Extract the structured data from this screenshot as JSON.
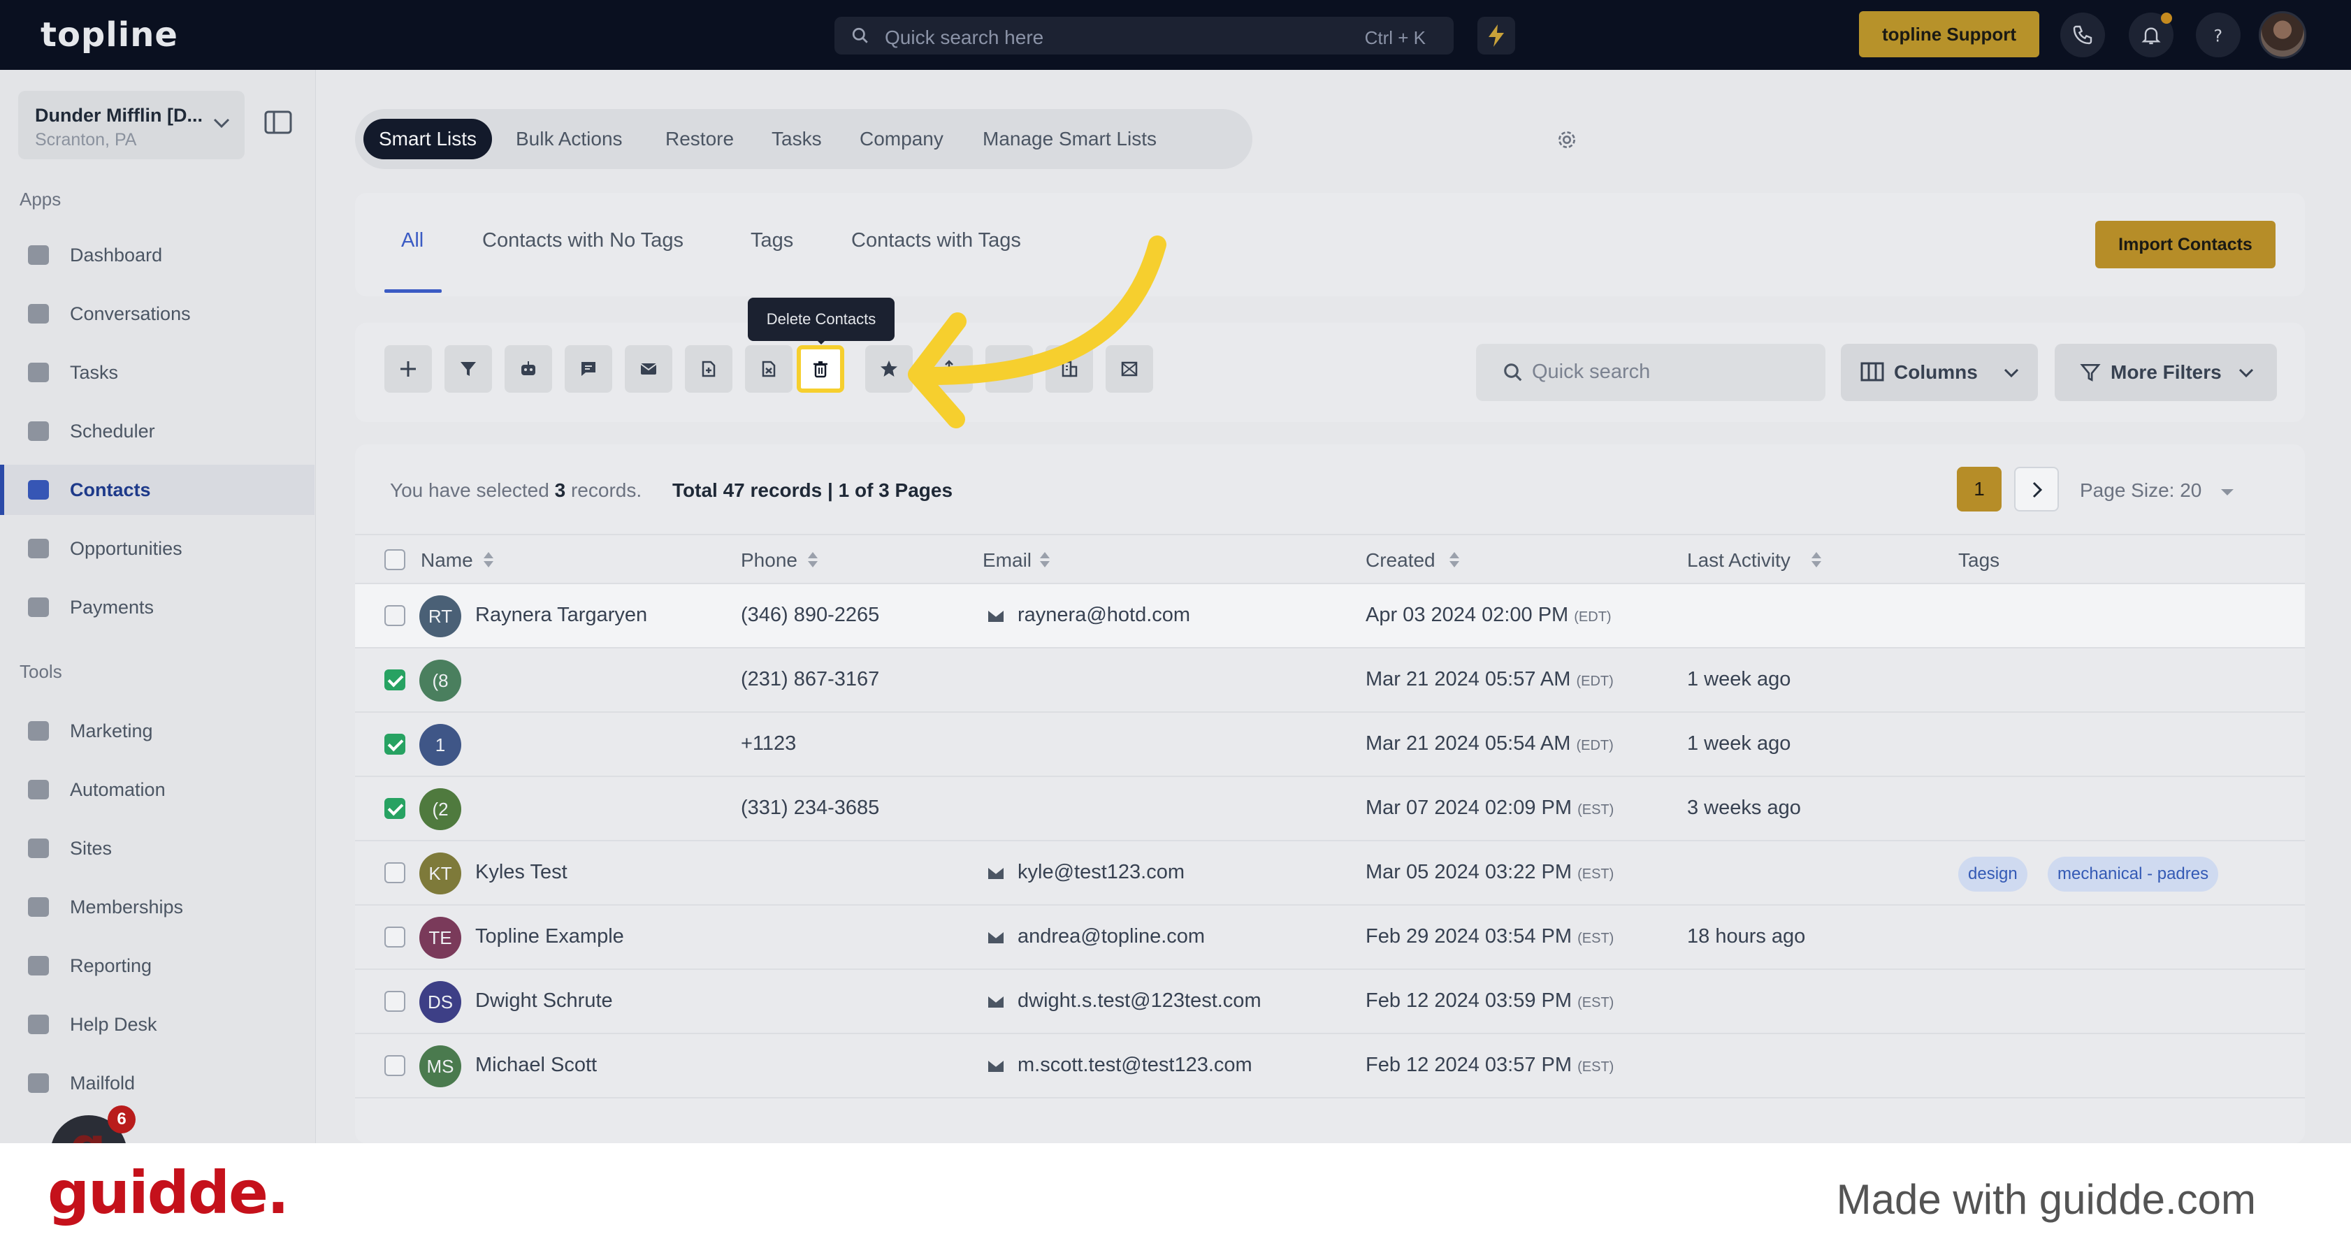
{
  "app": {
    "logo": "topline"
  },
  "header": {
    "search_placeholder": "Quick search here",
    "search_shortcut": "Ctrl + K",
    "support_label": "topline Support"
  },
  "sidebar": {
    "location_name": "Dunder Mifflin [D...",
    "location_sub": "Scranton, PA",
    "apps_label": "Apps",
    "tools_label": "Tools",
    "apps": [
      {
        "label": "Dashboard"
      },
      {
        "label": "Conversations"
      },
      {
        "label": "Tasks"
      },
      {
        "label": "Scheduler"
      },
      {
        "label": "Contacts"
      },
      {
        "label": "Opportunities"
      },
      {
        "label": "Payments"
      }
    ],
    "tools": [
      {
        "label": "Marketing"
      },
      {
        "label": "Automation"
      },
      {
        "label": "Sites"
      },
      {
        "label": "Memberships"
      },
      {
        "label": "Reporting"
      },
      {
        "label": "Help Desk"
      },
      {
        "label": "Mailfold"
      }
    ],
    "chat_count": "6"
  },
  "top_tabs": [
    "Smart Lists",
    "Bulk Actions",
    "Restore",
    "Tasks",
    "Company",
    "Manage Smart Lists"
  ],
  "sub_tabs": [
    "All",
    "Contacts with No Tags",
    "Tags",
    "Contacts with Tags"
  ],
  "import_label": "Import Contacts",
  "toolbar": {
    "tooltip": "Delete Contacts",
    "quick_search_placeholder": "Quick search",
    "columns_label": "Columns",
    "more_filters_label": "More Filters"
  },
  "records": {
    "selected_prefix": "You have selected",
    "selected_count": "3",
    "selected_suffix": "records.",
    "total": "Total 47 records | 1 of 3 Pages",
    "page": "1",
    "page_size": "Page Size: 20"
  },
  "table": {
    "headers": [
      "Name",
      "Phone",
      "Email",
      "Created",
      "Last Activity",
      "Tags"
    ],
    "rows": [
      {
        "initials": "RT",
        "color": "#4a6076",
        "name": "Raynera Targaryen",
        "phone": "(346) 890-2265",
        "email": "raynera@hotd.com",
        "created": "Apr 03 2024 02:00 PM",
        "tz": "(EDT)",
        "activity": "",
        "checked": false,
        "tags": []
      },
      {
        "initials": "(8",
        "color": "#4a7f5e",
        "name": "",
        "phone": "(231) 867-3167",
        "email": "",
        "created": "Mar 21 2024 05:57 AM",
        "tz": "(EDT)",
        "activity": "1 week ago",
        "checked": true,
        "tags": []
      },
      {
        "initials": "1",
        "color": "#3f5687",
        "name": "",
        "phone": "+1123",
        "email": "",
        "created": "Mar 21 2024 05:54 AM",
        "tz": "(EDT)",
        "activity": "1 week ago",
        "checked": true,
        "tags": []
      },
      {
        "initials": "(2",
        "color": "#4f7a3e",
        "name": "",
        "phone": "(331) 234-3685",
        "email": "",
        "created": "Mar 07 2024 02:09 PM",
        "tz": "(EST)",
        "activity": "3 weeks ago",
        "checked": true,
        "tags": []
      },
      {
        "initials": "KT",
        "color": "#7e7a3a",
        "name": "Kyles Test",
        "phone": "",
        "email": "kyle@test123.com",
        "created": "Mar 05 2024 03:22 PM",
        "tz": "(EST)",
        "activity": "",
        "checked": false,
        "tags": [
          "design",
          "mechanical - padres"
        ]
      },
      {
        "initials": "TE",
        "color": "#7a3a5a",
        "name": "Topline Example",
        "phone": "",
        "email": "andrea@topline.com",
        "created": "Feb 29 2024 03:54 PM",
        "tz": "(EST)",
        "activity": "18 hours ago",
        "checked": false,
        "tags": []
      },
      {
        "initials": "DS",
        "color": "#3d3f86",
        "name": "Dwight Schrute",
        "phone": "",
        "email": "dwight.s.test@123test.com",
        "created": "Feb 12 2024 03:59 PM",
        "tz": "(EST)",
        "activity": "",
        "checked": false,
        "tags": []
      },
      {
        "initials": "MS",
        "color": "#4a7a4e",
        "name": "Michael Scott",
        "phone": "",
        "email": "m.scott.test@test123.com",
        "created": "Feb 12 2024 03:57 PM",
        "tz": "(EST)",
        "activity": "",
        "checked": false,
        "tags": []
      }
    ]
  },
  "footer": {
    "brand": "guidde.",
    "made_with": "Made with guidde.com"
  },
  "colors": {
    "accent": "#b68d28",
    "highlight": "#f6cf2e",
    "active_nav": "#2b4aa8",
    "brand_red": "#c5111b"
  }
}
